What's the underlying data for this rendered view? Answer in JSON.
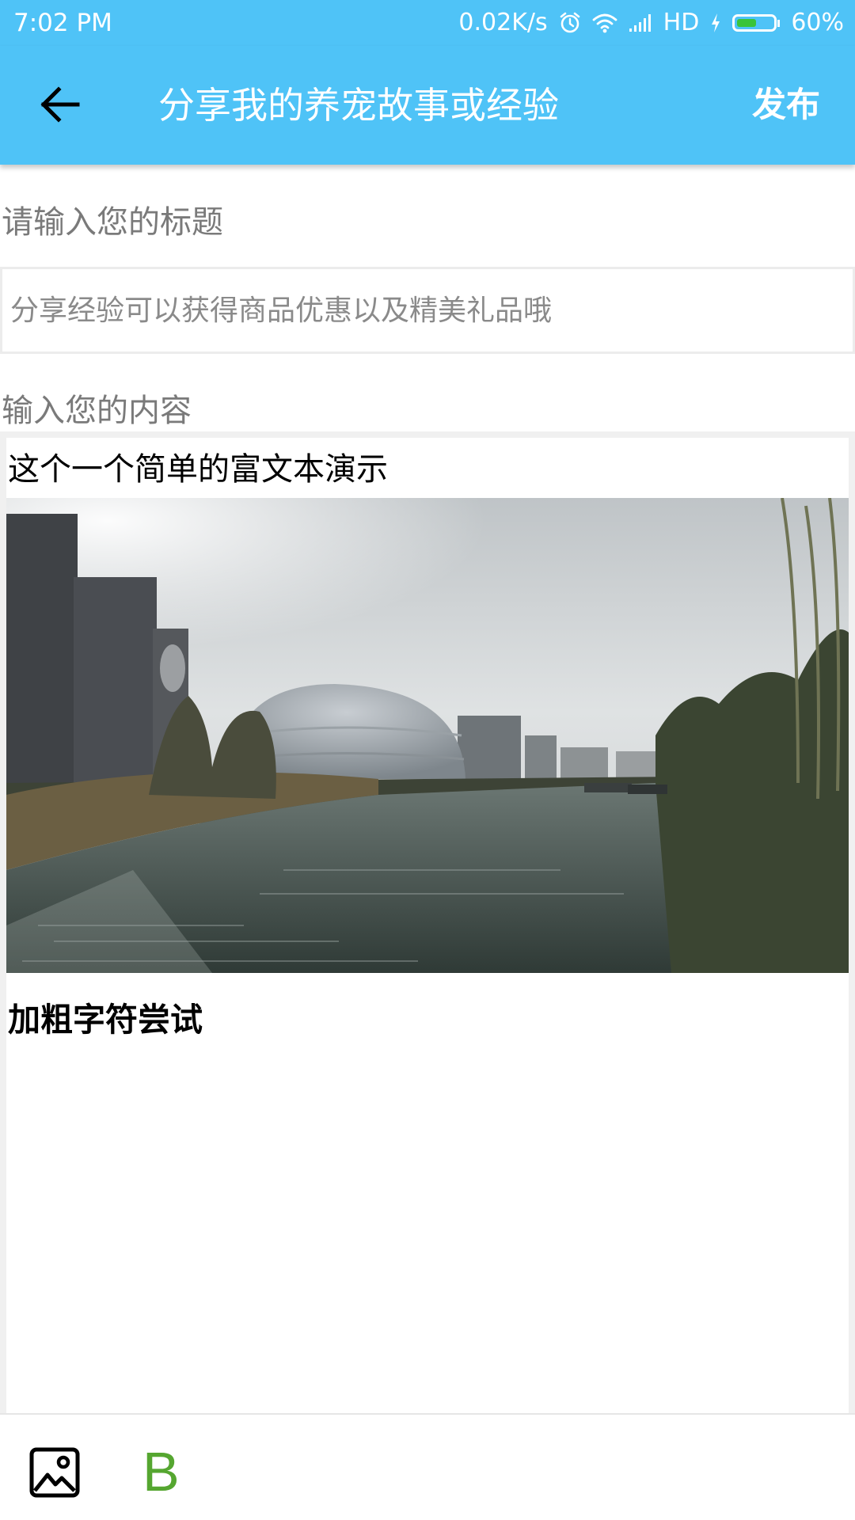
{
  "status_bar": {
    "time": "7:02  PM",
    "network_speed": "0.02K/s",
    "network_type": "HD",
    "battery": "60%",
    "battery_level": 0.6,
    "icons": [
      "alarm-icon",
      "wifi-icon",
      "signal-icon",
      "charging-icon",
      "battery-icon"
    ]
  },
  "toolbar": {
    "back_icon": "arrow-left-icon",
    "title": "分享我的养宠故事或经验",
    "publish_label": "发布"
  },
  "form": {
    "title_label": "请输入您的标题",
    "title_placeholder": "分享经验可以获得商品优惠以及精美礼品哦",
    "title_value": "",
    "content_label": "输入您的内容"
  },
  "editor": {
    "text": "这个一个简单的富文本演示",
    "image_description_icon": "embedded-photo",
    "bold_text": "加粗字符尝试"
  },
  "bottom_bar": {
    "insert_image_icon": "image-icon",
    "bold_label": "B"
  },
  "colors": {
    "primary": "#4fc3f7",
    "bold_button": "#55a630",
    "label_gray": "#7a7a7a",
    "battery_fill": "#39c43a"
  }
}
